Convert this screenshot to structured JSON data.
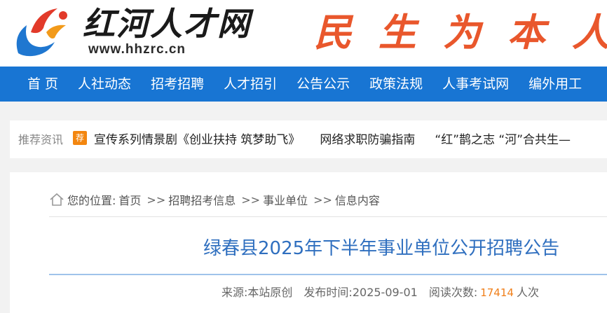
{
  "header": {
    "site_name": "红河人才网",
    "site_url": "www.hhzrc.cn",
    "slogan": "民生为本人"
  },
  "nav": {
    "items": [
      "首 页",
      "人社动态",
      "招考招聘",
      "人才招引",
      "公告公示",
      "政策法规",
      "人事考试网",
      "编外用工"
    ]
  },
  "ticker": {
    "title": "推荐资讯",
    "badge": "荐",
    "items": [
      "宣传系列情景剧《创业扶持 筑梦助飞》",
      "网络求职防骗指南",
      "“红”鹊之志 “河”合共生—"
    ]
  },
  "breadcrumb": {
    "prefix": "您的位置:",
    "items": [
      "首页",
      "招聘招考信息",
      "事业单位",
      "信息内容"
    ],
    "separator": ">>"
  },
  "article": {
    "title": "绿春县2025年下半年事业单位公开招聘公告",
    "source_label": "来源:",
    "source": "本站原创",
    "date_label": "发布时间:",
    "date": "2025-09-01",
    "views_label": "阅读次数:",
    "views": "17414",
    "views_unit": "人次"
  },
  "colors": {
    "nav_bg": "#1875d3",
    "slogan": "#e9572c",
    "title": "#2f6fbf",
    "badge": "#f3860f",
    "count": "#f07f1a"
  }
}
